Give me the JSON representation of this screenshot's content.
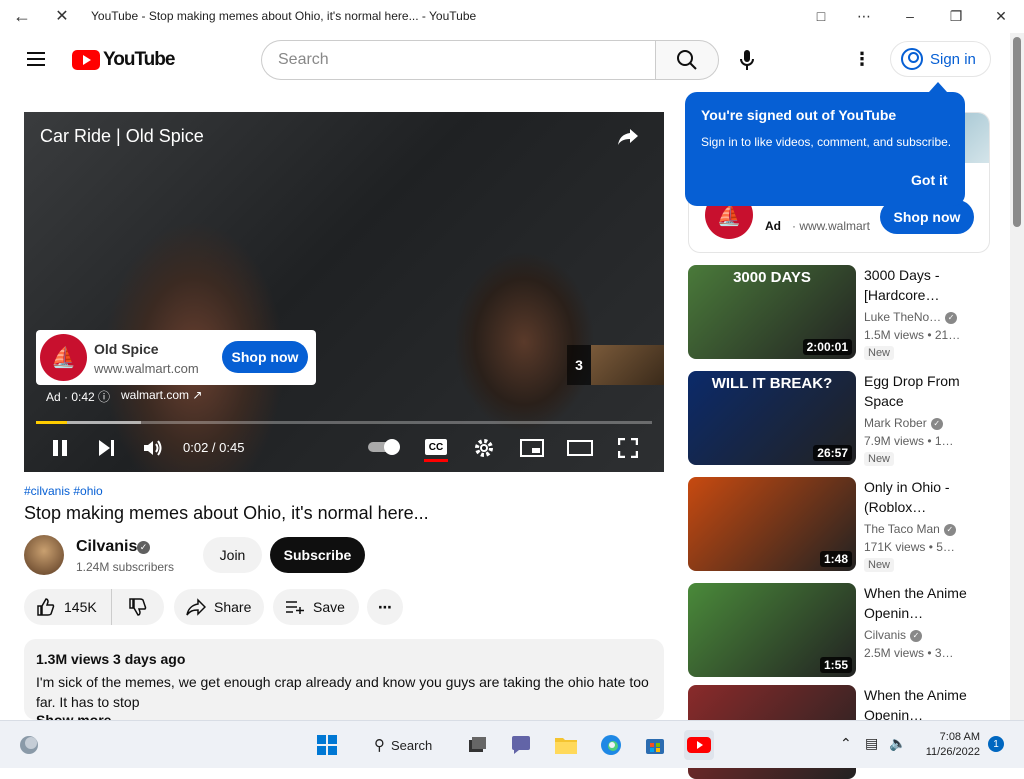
{
  "browser": {
    "title": "YouTube - Stop making memes about Ohio, it's normal here... - YouTube"
  },
  "header": {
    "logo_text": "YouTube",
    "search_placeholder": "Search",
    "signin_label": "Sign in"
  },
  "player": {
    "ad_title": "Car Ride | Old Spice",
    "ad_card_name": "Old Spice",
    "ad_card_url": "www.walmart.com",
    "ad_card_button": "Shop now",
    "ad_info": "Ad · 0:42",
    "ad_link": "walmart.com",
    "ad_count": "3",
    "time": "0:02 / 0:45",
    "progress": 0.05,
    "buffered": 0.17,
    "cc_label": "CC"
  },
  "video": {
    "hashtags": "#cilvanis #ohio",
    "title": "Stop making memes about Ohio, it's normal here...",
    "channel": "Cilvanis",
    "subscribers": "1.24M subscribers",
    "join_label": "Join",
    "subscribe_label": "Subscribe",
    "likes": "145K",
    "share_label": "Share",
    "save_label": "Save",
    "desc_meta": "1.3M views  3 days ago",
    "desc_text": "I'm sick of the memes, we get enough crap already and know you guys are taking the ohio hate too far. It has to stop",
    "show_more": "Show more"
  },
  "tooltip": {
    "title": "You're signed out of YouTube",
    "body": "Sign in to like videos, comment, and subscribe.",
    "button": "Got it"
  },
  "sidebar_ad": {
    "label": "Ad",
    "url": "· www.walmart",
    "button": "Shop now"
  },
  "recommendations": [
    {
      "title": "3000 Days - [Hardcore…",
      "channel": "Luke TheNo…",
      "views": "1.5M views  • 21…",
      "duration": "2:00:01",
      "badge": "New",
      "thumb_text": "3000 DAYS",
      "thumb_color": "#4a7a3a"
    },
    {
      "title": "Egg Drop From Space",
      "channel": "Mark Rober",
      "views": "7.9M views  • 1…",
      "duration": "26:57",
      "badge": "New",
      "thumb_text": "WILL IT BREAK?",
      "thumb_color": "#0b2a6a"
    },
    {
      "title": "Only in Ohio - (Roblox…",
      "channel": "The Taco Man",
      "views": "171K views  • 5…",
      "duration": "1:48",
      "badge": "New",
      "thumb_text": "",
      "thumb_color": "#c84a10"
    },
    {
      "title": "When the Anime Openin…",
      "channel": "Cilvanis",
      "views": "2.5M views  • 3…",
      "duration": "1:55",
      "badge": "",
      "thumb_text": "",
      "thumb_color": "#4a8a3a"
    },
    {
      "title": "When the Anime Openin…",
      "channel": "",
      "views": "",
      "duration": "",
      "badge": "",
      "thumb_text": "",
      "thumb_color": "#8a2a2a"
    }
  ],
  "taskbar": {
    "search_label": "Search",
    "time": "7:08 AM",
    "date": "11/26/2022",
    "notification_count": "1"
  }
}
